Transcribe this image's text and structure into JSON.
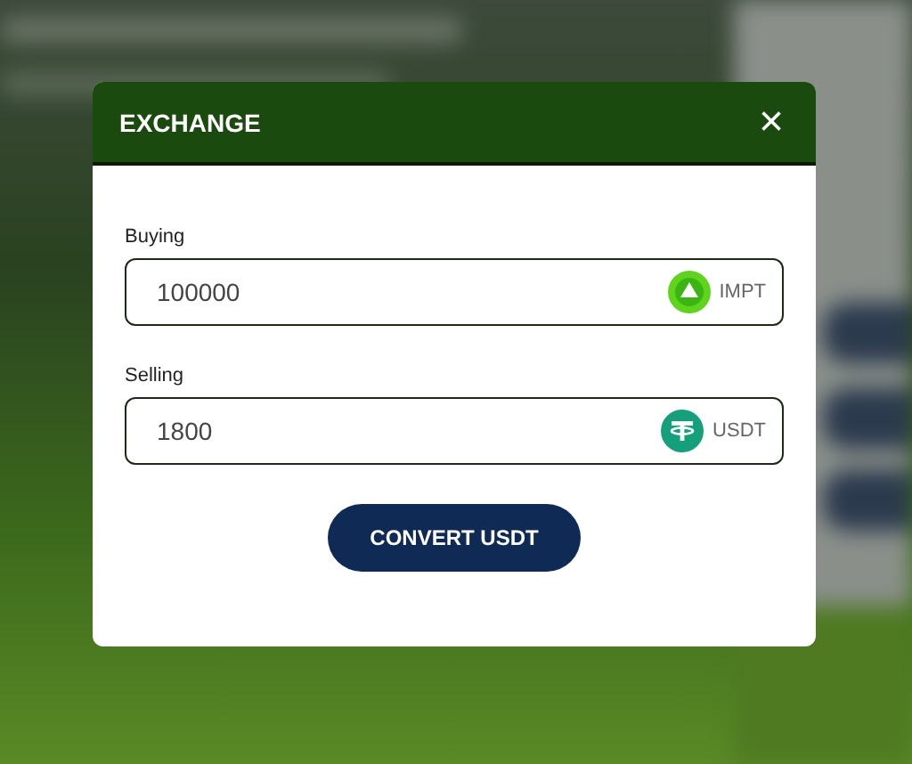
{
  "dialog": {
    "title": "EXCHANGE",
    "close": "×",
    "fields": [
      {
        "label": "Buying",
        "value": "100000",
        "currency": "IMPT",
        "kind": "impt"
      },
      {
        "label": "Selling",
        "value": "1800",
        "currency": "USDT",
        "kind": "usdt"
      }
    ],
    "button": "CONVERT USDT"
  }
}
